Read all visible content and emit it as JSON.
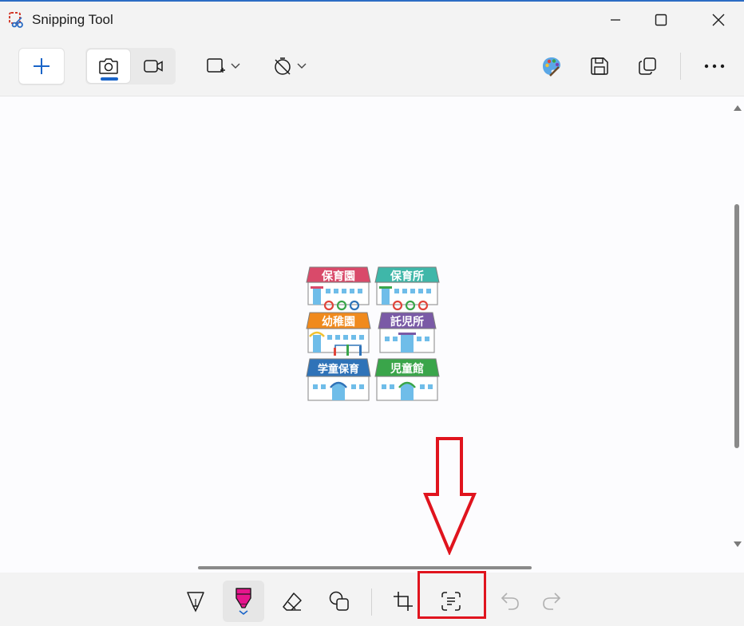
{
  "window": {
    "title": "Snipping Tool",
    "icons": [
      "snipping-tool-icon",
      "minimize-icon",
      "maximize-icon",
      "close-icon"
    ]
  },
  "toolbar": {
    "new_button_icon": "plus-icon",
    "modes": [
      {
        "name": "screenshot",
        "icon": "camera-icon",
        "selected": true
      },
      {
        "name": "video",
        "icon": "video-camera-icon",
        "selected": false
      }
    ],
    "snip_mode_icon": "rectangle-snip-icon",
    "delay_icon": "no-timer-icon",
    "right_icons": [
      "paint-palette-icon",
      "save-icon",
      "copy-icon",
      "more-icon"
    ]
  },
  "canvas": {
    "image_labels": [
      "保育園",
      "保育所",
      "幼稚園",
      "託児所",
      "学童保育",
      "児童館"
    ]
  },
  "bottom_toolbar": {
    "tools": [
      "ballpoint-pen-icon",
      "highlighter-icon",
      "eraser-icon",
      "shapes-icon",
      "crop-icon",
      "text-actions-icon",
      "undo-icon",
      "redo-icon"
    ],
    "active_tool": "highlighter-icon",
    "highlighted_tool": "text-actions-icon"
  },
  "colors": {
    "accent": "#1964c8",
    "annotation_red": "#e0141e",
    "highlighter_pink": "#e6158c",
    "label_reds": "#d94a6a",
    "label_teal": "#3fb7a9",
    "label_orange": "#f08a1d",
    "label_purple": "#7a5aa6",
    "label_blue": "#2f73b8",
    "label_green": "#3aa54a"
  }
}
